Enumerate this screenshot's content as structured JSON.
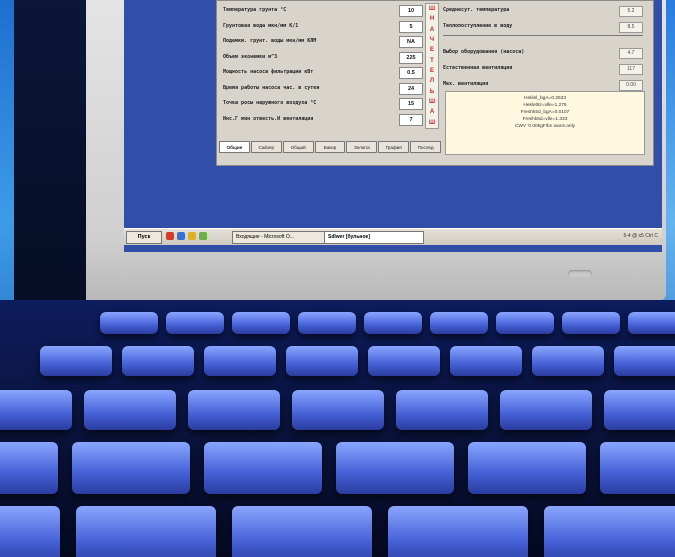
{
  "window": {
    "left_rows": [
      {
        "label": "Температура грунта °С",
        "value": "10"
      },
      {
        "label": "Грунтовая вода мкн/мм К/1",
        "value": "5"
      },
      {
        "label": "Подемкм. грунт. воды мкн/мм КЛМ",
        "value": "NA"
      },
      {
        "label": "Объем эконемки м^3",
        "value": "225"
      },
      {
        "label": "Мощность насоса фильтрации кВт",
        "value": "0.5"
      },
      {
        "label": "Время работы насоса час. в сутки",
        "value": "24"
      },
      {
        "label": "Точка росы наружного воздуха °С",
        "value": "15"
      },
      {
        "label": "Инс.Г мин отвесть.И вентиляция",
        "value": "7"
      }
    ],
    "vertical_strip": [
      "Ш",
      "Н",
      "А",
      "Ч",
      "Е",
      "Т",
      "Е",
      "Л",
      "Ь",
      "Ш",
      "А",
      "Ш"
    ],
    "right_rows": [
      {
        "label": "Среднесут. температура",
        "value": "5.2"
      },
      {
        "label": "Теплопоступление в воду",
        "value": "8.5"
      },
      {
        "label": "Выбор оборудования (насоса)",
        "value": "4.7"
      },
      {
        "label": "Естественная вентиляция",
        "value": "117"
      },
      {
        "label": "Мех. вентиляция",
        "value": "0.00"
      }
    ],
    "info_lines": [
      "Heklel_bgA=0.2533",
      "Heklel5z=vlle=1.275",
      "Freshk5d_bgA=0.0107",
      "Freshk5d=vlle=1.333",
      "",
      "CWV '0.00kgF/bn wans.only"
    ],
    "tabs": [
      "Общие",
      "Сайзер",
      "Общий",
      "Бакер",
      "Зелюта",
      "Графия",
      "Послед"
    ]
  },
  "taskbar": {
    "start_label": "Пуск",
    "tasks": [
      "Входящие - Microsoft O...",
      "Sdlwer [бульное]"
    ],
    "tray": "5-4 @ x5 Ctrl C"
  },
  "colors": {
    "screen_bg": "#314fa8",
    "window_bg": "#d8d4cc",
    "strip_text": "#c8202a",
    "keyboard": "#4560d6"
  }
}
